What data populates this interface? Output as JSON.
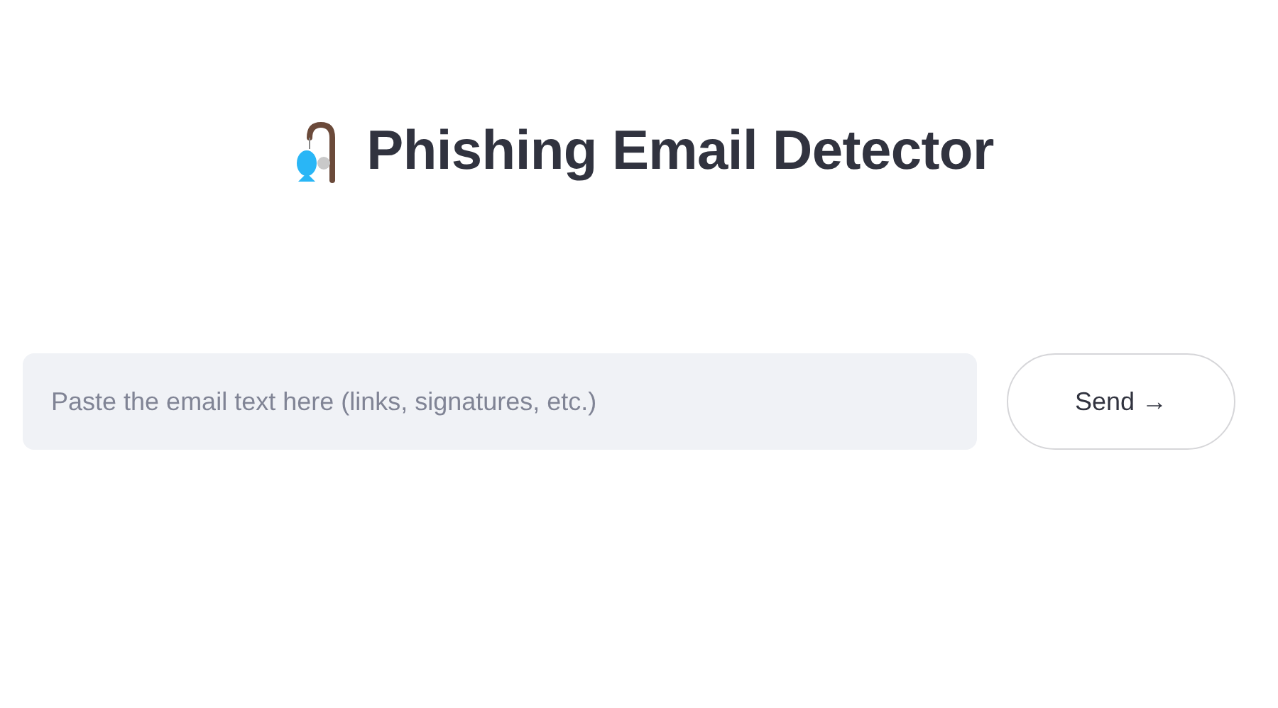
{
  "title": "Phishing Email Detector",
  "input": {
    "placeholder": "Paste the email text here (links, signatures, etc.)"
  },
  "send_button": {
    "label": "Send →"
  }
}
